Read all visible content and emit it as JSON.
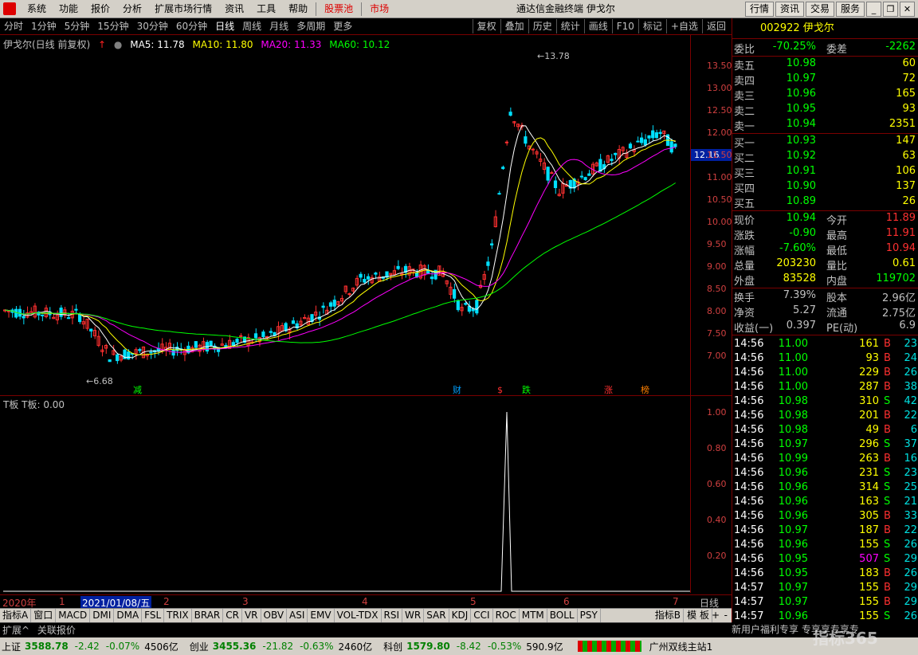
{
  "menu": {
    "items": [
      "系统",
      "功能",
      "报价",
      "分析",
      "扩展市场行情",
      "资讯",
      "工具",
      "帮助"
    ],
    "stock_pool": "股票池",
    "market": "市场",
    "title": "通达信金融终端 伊戈尔",
    "right_buttons": [
      "行情",
      "资讯",
      "交易",
      "服务"
    ]
  },
  "periods": {
    "items": [
      "分时",
      "1分钟",
      "5分钟",
      "15分钟",
      "30分钟",
      "60分钟",
      "日线",
      "周线",
      "月线",
      "多周期",
      "更多"
    ],
    "active": "日线",
    "tools": [
      "复权",
      "叠加",
      "历史",
      "统计",
      "画线",
      "F10",
      "标记",
      "+自选",
      "返回"
    ]
  },
  "chart_header": {
    "name": "伊戈尔(日线 前复权)",
    "ma5": "MA5: 11.78",
    "ma10": "MA10: 11.80",
    "ma20": "MA20: 11.33",
    "ma60": "MA60: 10.12",
    "colors": {
      "ma5": "#ffffff",
      "ma10": "#ffff00",
      "ma20": "#ff00ff",
      "ma60": "#00ff00"
    }
  },
  "chart_data": {
    "type": "candlestick",
    "y_ticks": [
      "13.50",
      "13.00",
      "12.50",
      "12.00",
      "11.50",
      "11.00",
      "10.50",
      "10.00",
      "9.50",
      "9.00",
      "8.50",
      "8.00",
      "7.50",
      "7.00"
    ],
    "ylim": [
      6.5,
      14.0
    ],
    "current_price_label": "12.16",
    "high_label": "13.78",
    "low_label": "6.68",
    "event_markers": [
      "减",
      "财",
      "$",
      "跌",
      "涨",
      "榜"
    ],
    "sub_indicator": "T板  T板: 0.00",
    "sub_y_ticks": [
      "1.00",
      "0.80",
      "0.60",
      "0.40",
      "0.20"
    ],
    "time_labels": [
      "2020年",
      "1",
      "2021/01/08/五",
      "2",
      "3",
      "4",
      "5",
      "6",
      "7"
    ],
    "period_label": "日线"
  },
  "indicators": [
    "指标A",
    "窗口",
    "MACD",
    "DMI",
    "DMA",
    "FSL",
    "TRIX",
    "BRAR",
    "CR",
    "VR",
    "OBV",
    "ASI",
    "EMV",
    "VOL-TDX",
    "RSI",
    "WR",
    "SAR",
    "KDJ",
    "CCI",
    "ROC",
    "MTM",
    "BOLL",
    "PSY"
  ],
  "indicator_right": [
    "指标B",
    "模 板",
    "+",
    "-"
  ],
  "ext_bar": [
    "扩展^",
    "关联报价"
  ],
  "quote": {
    "code": "002922",
    "name": "伊戈尔",
    "weibi_label": "委比",
    "weibi": "-70.25%",
    "weicha_label": "委差",
    "weicha": "-2262",
    "asks": [
      {
        "label": "卖五",
        "price": "10.98",
        "vol": "60"
      },
      {
        "label": "卖四",
        "price": "10.97",
        "vol": "72"
      },
      {
        "label": "卖三",
        "price": "10.96",
        "vol": "165"
      },
      {
        "label": "卖二",
        "price": "10.95",
        "vol": "93"
      },
      {
        "label": "卖一",
        "price": "10.94",
        "vol": "2351"
      }
    ],
    "bids": [
      {
        "label": "买一",
        "price": "10.93",
        "vol": "147"
      },
      {
        "label": "买二",
        "price": "10.92",
        "vol": "63"
      },
      {
        "label": "买三",
        "price": "10.91",
        "vol": "106"
      },
      {
        "label": "买四",
        "price": "10.90",
        "vol": "137"
      },
      {
        "label": "买五",
        "price": "10.89",
        "vol": "26"
      }
    ],
    "stats": [
      {
        "l1": "现价",
        "v1": "10.94",
        "l2": "今开",
        "v2": "11.89"
      },
      {
        "l1": "涨跌",
        "v1": "-0.90",
        "l2": "最高",
        "v2": "11.91"
      },
      {
        "l1": "涨幅",
        "v1": "-7.60%",
        "l2": "最低",
        "v2": "10.94"
      },
      {
        "l1": "总量",
        "v1": "203230",
        "l2": "量比",
        "v2": "0.61"
      },
      {
        "l1": "外盘",
        "v1": "83528",
        "l2": "内盘",
        "v2": "119702"
      }
    ],
    "stats2": [
      {
        "l1": "换手",
        "v1": "7.39%",
        "l2": "股本",
        "v2": "2.96亿"
      },
      {
        "l1": "净资",
        "v1": "5.27",
        "l2": "流通",
        "v2": "2.75亿"
      },
      {
        "l1": "收益(一)",
        "v1": "0.397",
        "l2": "PE(动)",
        "v2": "6.9"
      }
    ]
  },
  "ticks": [
    {
      "t": "14:56",
      "p": "11.00",
      "v": "161",
      "bs": "B",
      "n": "23"
    },
    {
      "t": "14:56",
      "p": "11.00",
      "v": "93",
      "bs": "B",
      "n": "24"
    },
    {
      "t": "14:56",
      "p": "11.00",
      "v": "229",
      "bs": "B",
      "n": "26"
    },
    {
      "t": "14:56",
      "p": "11.00",
      "v": "287",
      "bs": "B",
      "n": "38"
    },
    {
      "t": "14:56",
      "p": "10.98",
      "v": "310",
      "bs": "S",
      "n": "42"
    },
    {
      "t": "14:56",
      "p": "10.98",
      "v": "201",
      "bs": "B",
      "n": "22"
    },
    {
      "t": "14:56",
      "p": "10.98",
      "v": "49",
      "bs": "B",
      "n": "6"
    },
    {
      "t": "14:56",
      "p": "10.97",
      "v": "296",
      "bs": "S",
      "n": "37"
    },
    {
      "t": "14:56",
      "p": "10.99",
      "v": "263",
      "bs": "B",
      "n": "16"
    },
    {
      "t": "14:56",
      "p": "10.96",
      "v": "231",
      "bs": "S",
      "n": "23"
    },
    {
      "t": "14:56",
      "p": "10.96",
      "v": "314",
      "bs": "S",
      "n": "25"
    },
    {
      "t": "14:56",
      "p": "10.96",
      "v": "163",
      "bs": "S",
      "n": "21"
    },
    {
      "t": "14:56",
      "p": "10.96",
      "v": "305",
      "bs": "B",
      "n": "33"
    },
    {
      "t": "14:56",
      "p": "10.97",
      "v": "187",
      "bs": "B",
      "n": "22"
    },
    {
      "t": "14:56",
      "p": "10.96",
      "v": "155",
      "bs": "S",
      "n": "26"
    },
    {
      "t": "14:56",
      "p": "10.95",
      "v": "507",
      "bs": "S",
      "n": "29"
    },
    {
      "t": "14:56",
      "p": "10.95",
      "v": "183",
      "bs": "B",
      "n": "26"
    },
    {
      "t": "14:57",
      "p": "10.97",
      "v": "155",
      "bs": "B",
      "n": "29"
    },
    {
      "t": "14:57",
      "p": "10.97",
      "v": "155",
      "bs": "B",
      "n": "29"
    },
    {
      "t": "14:57",
      "p": "10.96",
      "v": "155",
      "bs": "S",
      "n": "26"
    }
  ],
  "rp_bottom": "新用户福利专享  专享享专享专",
  "status": {
    "sh_label": "上证",
    "sh": "3588.78",
    "sh_chg": "-2.42",
    "sh_pct": "-0.07%",
    "sh_amt": "4506亿",
    "cy_label": "创业",
    "cy": "3455.36",
    "cy_chg": "-21.82",
    "cy_pct": "-0.63%",
    "cy_amt": "2460亿",
    "kc_label": "科创",
    "kc": "1579.80",
    "kc_chg": "-8.42",
    "kc_pct": "-0.53%",
    "kc_amt": "590.9亿",
    "site": "广州双线主站1"
  },
  "watermark": "指标365"
}
